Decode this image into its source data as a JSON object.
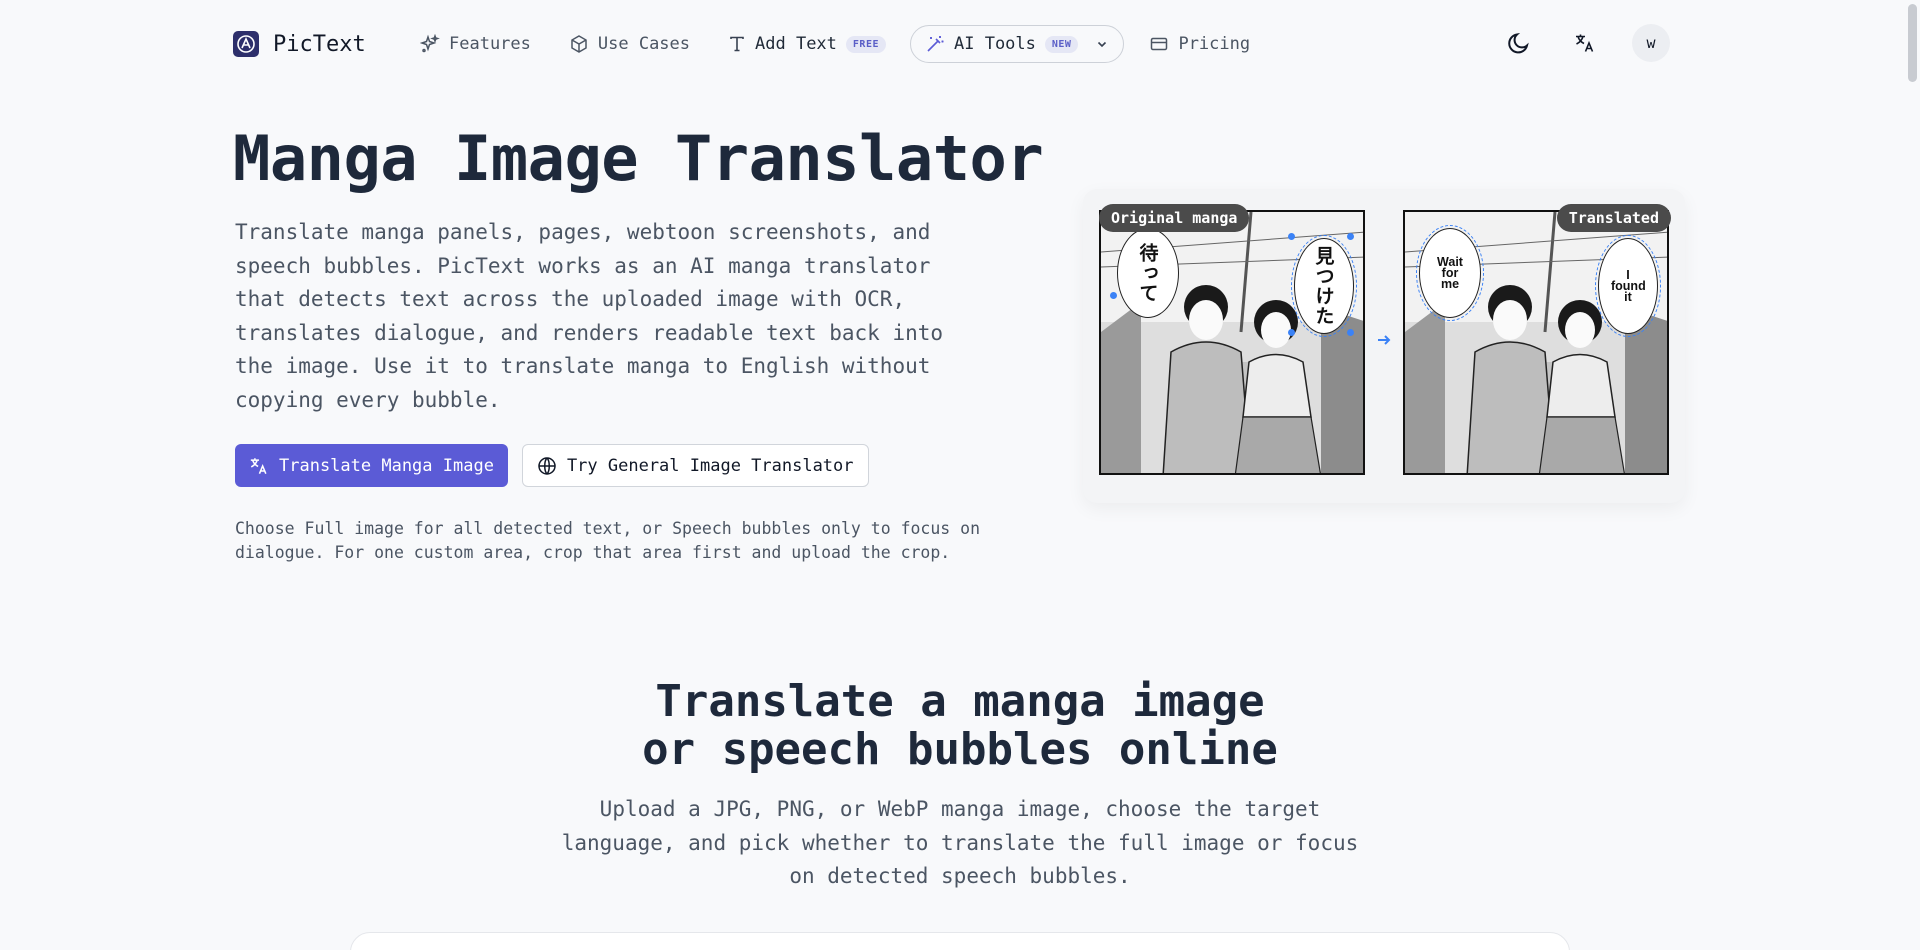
{
  "nav": {
    "brand": "PicText",
    "links": [
      {
        "label": "Features",
        "icon": "sparkles-icon"
      },
      {
        "label": "Use Cases",
        "icon": "cube-icon"
      },
      {
        "label": "Add Text",
        "icon": "text-icon",
        "badge": "FREE"
      },
      {
        "label": "AI Tools",
        "icon": "magic-wand-icon",
        "badge": "NEW"
      },
      {
        "label": "Pricing",
        "icon": "card-icon"
      }
    ],
    "avatar_initial": "w"
  },
  "hero": {
    "title": "Manga Image Translator",
    "description": "Translate manga panels, pages, webtoon screenshots, and speech bubbles. PicText works as an AI manga translator that detects text across the uploaded image with OCR, translates dialogue, and renders readable text back into the image. Use it to translate manga to English without copying every bubble.",
    "primary_button": "Translate Manga Image",
    "secondary_button": "Try General Image Translator",
    "hint": "Choose Full image for all detected text, or Speech bubbles only to focus on dialogue. For one custom area, crop that area first and upload the crop."
  },
  "preview": {
    "left_tag": "Original manga",
    "right_tag": "Translated",
    "original_bubbles": [
      "待って",
      "見つけた"
    ],
    "translated_bubbles": [
      "Wait for me",
      "I found it"
    ]
  },
  "section2": {
    "title_line1": "Translate a manga image",
    "title_line2": "or speech bubbles online",
    "description": "Upload a JPG, PNG, or WebP manga image, choose the target language, and pick whether to translate the full image or focus on detected speech bubbles."
  },
  "colors": {
    "accent": "#5b5bd6",
    "selection": "#3b82f6",
    "background": "#f8f9fb"
  }
}
